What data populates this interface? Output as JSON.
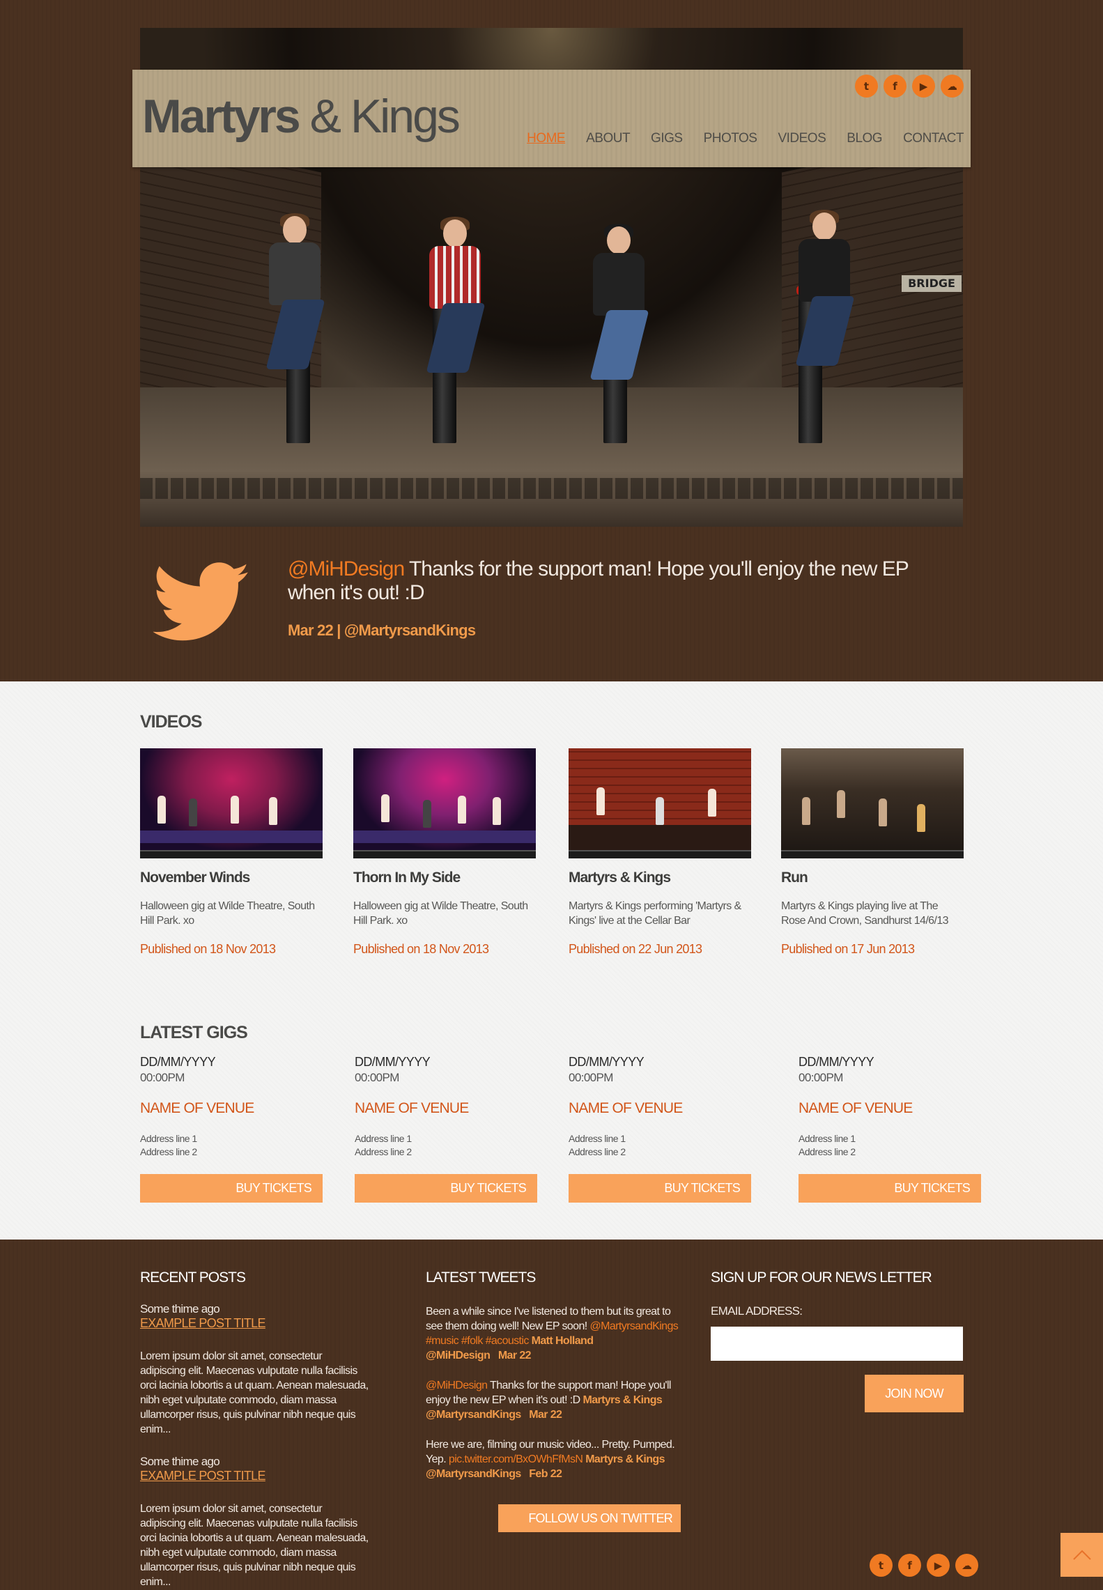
{
  "header": {
    "logo_strong": "Martyrs",
    "logo_light": "& Kings",
    "social": [
      {
        "icon": "twitter-icon",
        "glyph": "t"
      },
      {
        "icon": "facebook-icon",
        "glyph": "f"
      },
      {
        "icon": "youtube-icon",
        "glyph": "▶"
      },
      {
        "icon": "soundcloud-icon",
        "glyph": "☁"
      }
    ],
    "nav": [
      "HOME",
      "ABOUT",
      "GIGS",
      "PHOTOS",
      "VIDEOS",
      "BLOG",
      "CONTACT"
    ],
    "active_nav": "HOME"
  },
  "hero": {
    "sign_text": "BRIDGE"
  },
  "featured_tweet": {
    "handle": "@MiHDesign",
    "text": " Thanks for the support man! Hope you'll enjoy the new EP when it's out! :D",
    "date": "Mar 22",
    "separator": " | ",
    "account": "@MartyrsandKings"
  },
  "videos": {
    "title": "VIDEOS",
    "items": [
      {
        "title": "November Winds",
        "desc": "Halloween gig at Wilde Theatre, South Hill Park. xo",
        "date": "Published on 18 Nov 2013"
      },
      {
        "title": "Thorn In My Side",
        "desc": "Halloween gig at Wilde Theatre, South Hill Park. xo",
        "date": "Published on 18 Nov 2013"
      },
      {
        "title": "Martyrs & Kings",
        "desc": "Martyrs & Kings performing 'Martyrs & Kings' live at the Cellar Bar",
        "date": "Published on 22 Jun 2013"
      },
      {
        "title": "Run",
        "desc": "Martyrs & Kings playing live at The Rose And Crown, Sandhurst 14/6/13",
        "date": "Published on 17 Jun 2013"
      }
    ]
  },
  "gigs": {
    "title": "LATEST GIGS",
    "items": [
      {
        "date": "DD/MM/YYYY",
        "time": "00:00PM",
        "venue": "NAME OF VENUE",
        "addr1": "Address line 1",
        "addr2": "Address line 2",
        "button": "BUY TICKETS"
      },
      {
        "date": "DD/MM/YYYY",
        "time": "00:00PM",
        "venue": "NAME OF VENUE",
        "addr1": "Address line 1",
        "addr2": "Address line 2",
        "button": "BUY TICKETS"
      },
      {
        "date": "DD/MM/YYYY",
        "time": "00:00PM",
        "venue": "NAME OF VENUE",
        "addr1": "Address line 1",
        "addr2": "Address line 2",
        "button": "BUY TICKETS"
      },
      {
        "date": "DD/MM/YYYY",
        "time": "00:00PM",
        "venue": "NAME OF VENUE",
        "addr1": "Address line 1",
        "addr2": "Address line 2",
        "button": "BUY TICKETS"
      }
    ]
  },
  "footer": {
    "recent_posts": {
      "title": "RECENT POSTS",
      "posts": [
        {
          "time": "Some thime ago",
          "link": "EXAMPLE POST TITLE",
          "body": "Lorem ipsum dolor sit amet, consectetur adipiscing elit. Maecenas vulputate nulla facilisis orci lacinia lobortis a ut quam. Aenean malesuada, nibh eget vulputate commodo, diam massa ullamcorper risus, quis pulvinar nibh neque quis enim..."
        },
        {
          "time": "Some thime ago",
          "link": "EXAMPLE POST TITLE",
          "body": "Lorem ipsum dolor sit amet, consectetur adipiscing elit. Maecenas vulputate nulla facilisis orci lacinia lobortis a ut quam. Aenean malesuada, nibh eget vulputate commodo, diam massa ullamcorper risus, quis pulvinar nibh neque quis enim..."
        }
      ]
    },
    "latest_tweets": {
      "title": "LATEST TWEETS",
      "t1_text": "Been a while since I've listened to them but its great to see them doing well! New EP soon! ",
      "t1_tags": "@MartyrsandKings #music #folk #acoustic",
      "t1_author": " Matt Holland @MiHDesign",
      "t1_date": "Mar 22",
      "t2_handle": "@MiHDesign",
      "t2_text": " Thanks for the support man! Hope you'll enjoy the new EP when it's out! :D ",
      "t2_author": "Martyrs & Kings @MartyrsandKings",
      "t2_date": "Mar 22",
      "t3_text": "Here we are, filming our music video... Pretty. Pumped. Yep. ",
      "t3_link": "pic.twitter.com/BxOWhFfMsN",
      "t3_author": " Martyrs & Kings @MartyrsandKings",
      "t3_date": "Feb 22",
      "follow_button": "FOLLOW US ON TWITTER"
    },
    "newsletter": {
      "title": "SIGN UP FOR OUR NEWS LETTER",
      "email_label": "EMAIL ADDRESS:",
      "email_value": "",
      "join_button": "JOIN NOW"
    }
  },
  "colors": {
    "brown_bg": "#4a3120",
    "accent_orange": "#f07a22",
    "button_orange": "#f9a25a",
    "header_tan": "#b6a586",
    "link_orange": "#d2561a"
  }
}
